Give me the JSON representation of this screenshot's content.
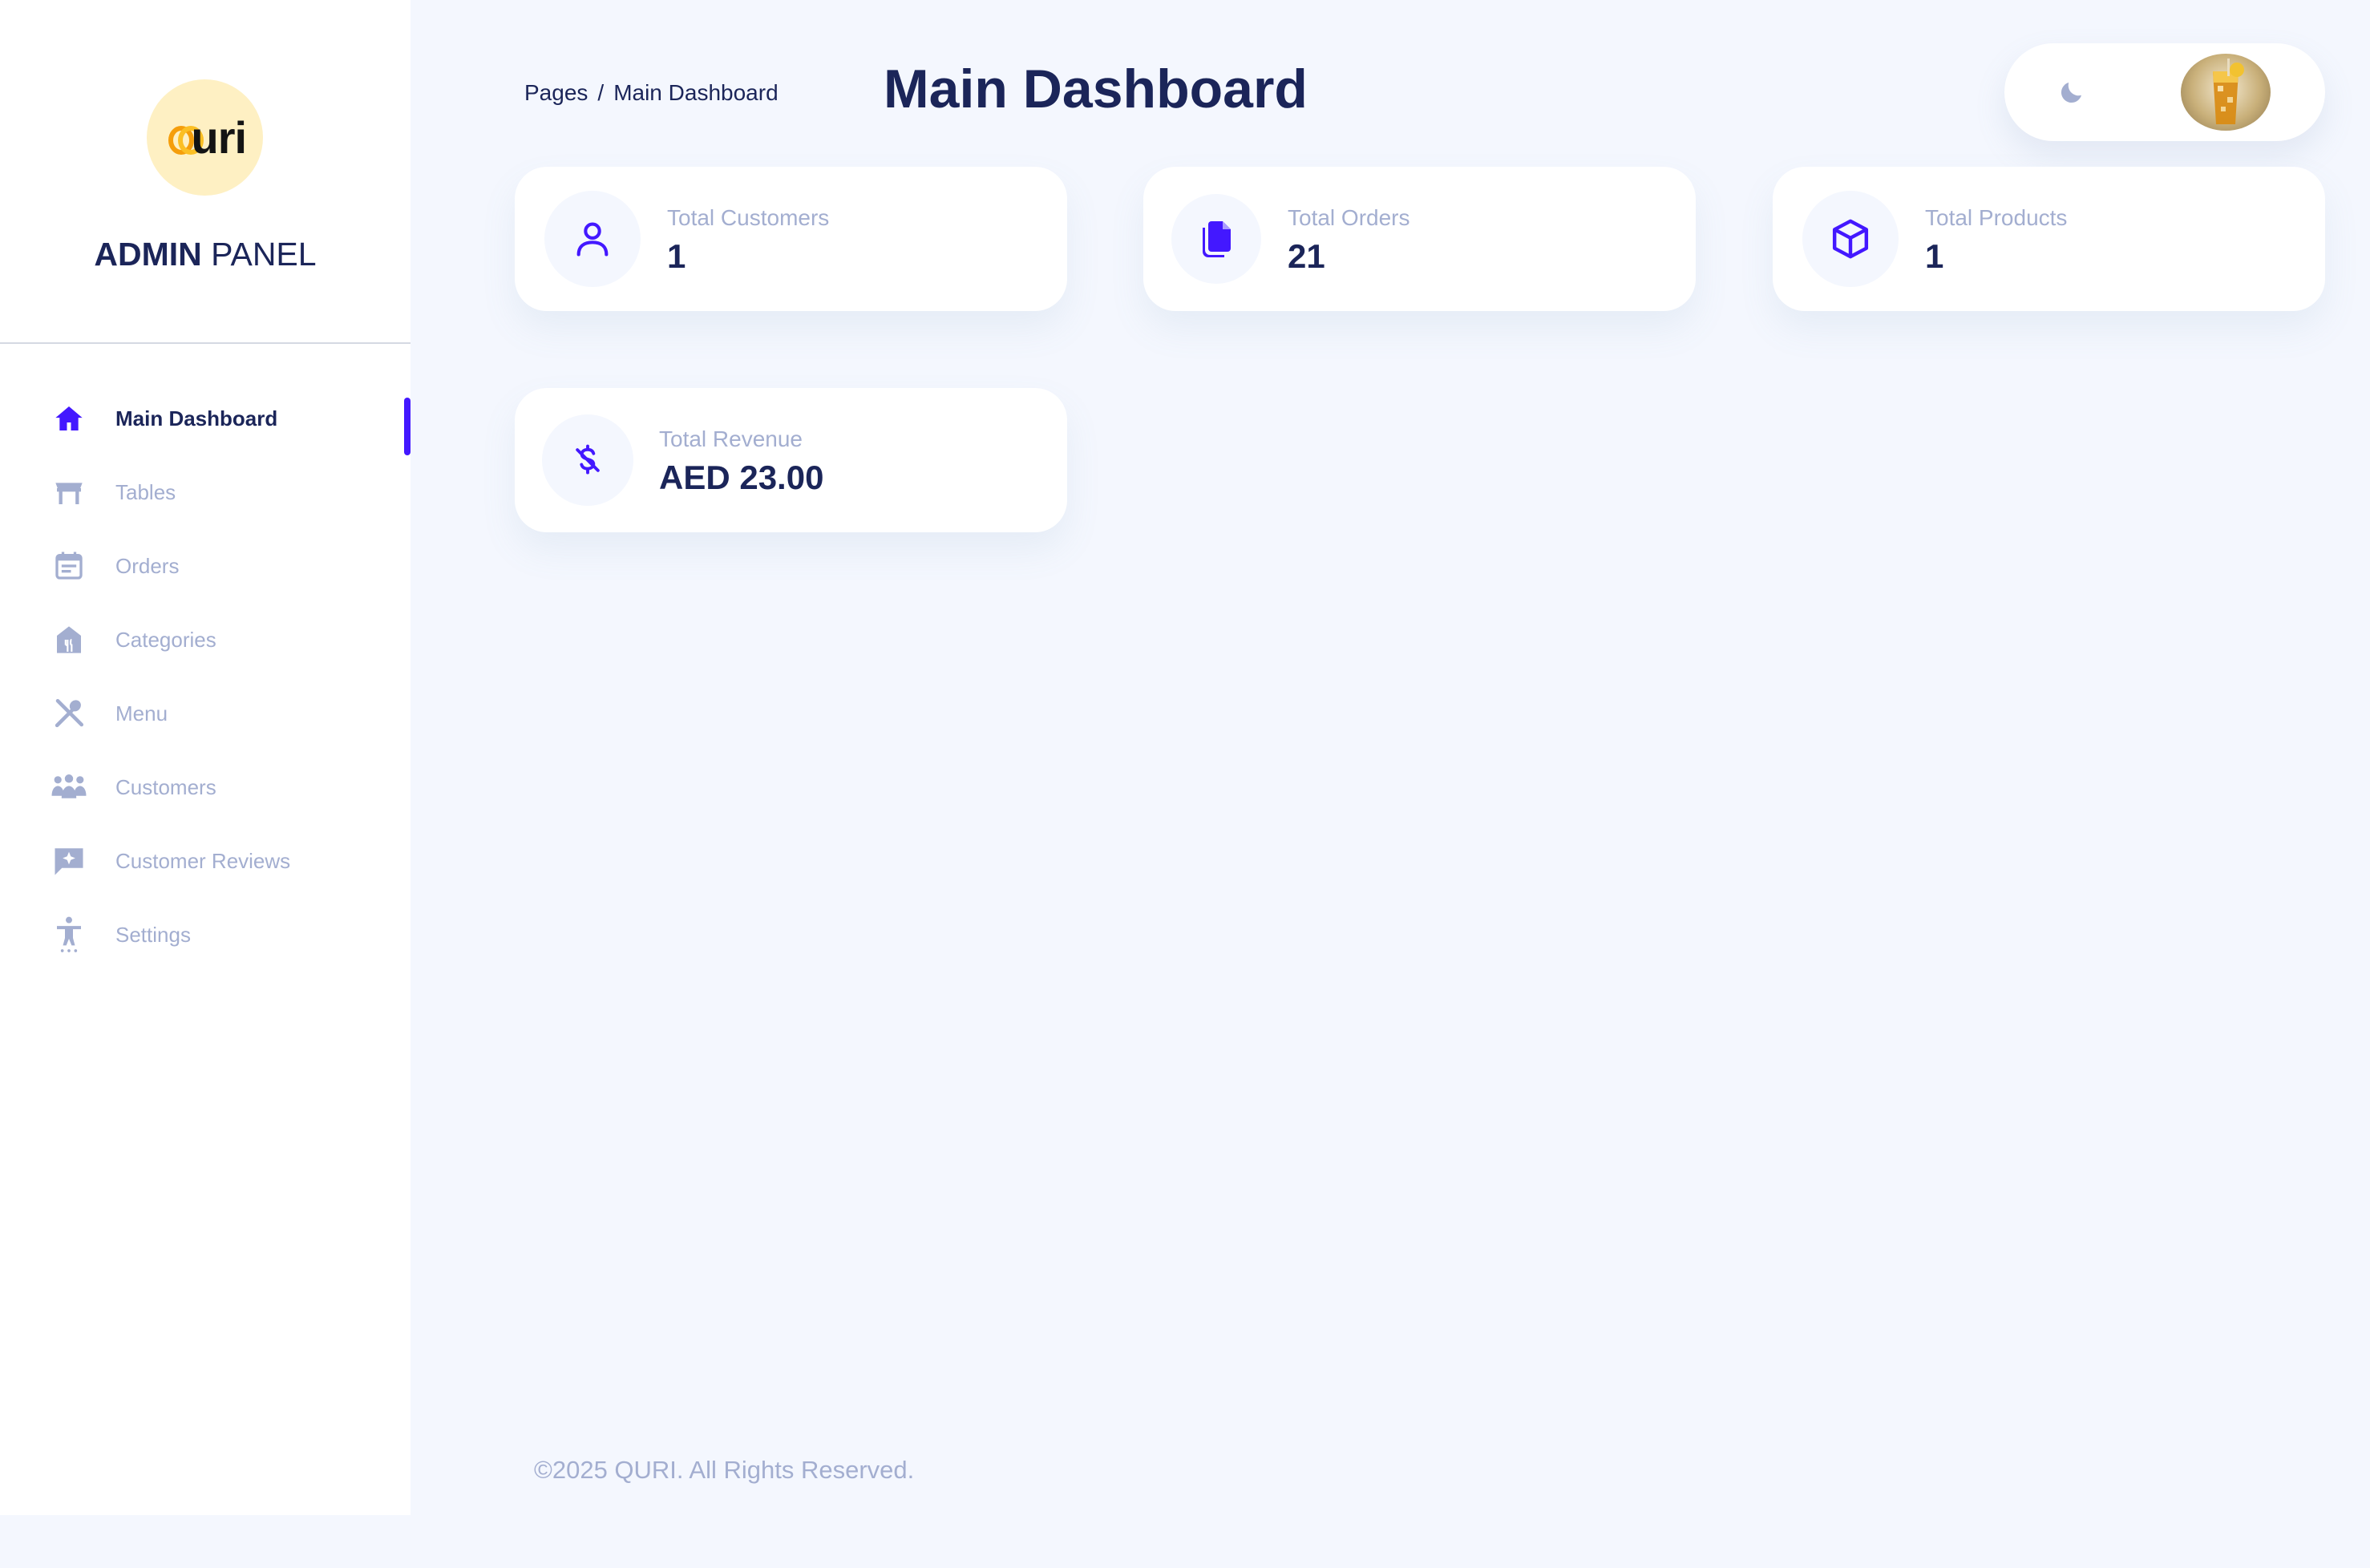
{
  "brand": {
    "logo_text": "uri",
    "title_bold": "ADMIN",
    "title_rest": "PANEL"
  },
  "sidebar": {
    "items": [
      {
        "label": "Main Dashboard",
        "icon": "home-icon",
        "active": true
      },
      {
        "label": "Tables",
        "icon": "table-icon"
      },
      {
        "label": "Orders",
        "icon": "calendar-icon"
      },
      {
        "label": "Categories",
        "icon": "store-icon"
      },
      {
        "label": "Menu",
        "icon": "utensils-icon"
      },
      {
        "label": "Customers",
        "icon": "people-icon"
      },
      {
        "label": "Customer Reviews",
        "icon": "review-icon"
      },
      {
        "label": "Settings",
        "icon": "accessibility-icon"
      }
    ]
  },
  "header": {
    "breadcrumb": {
      "parent": "Pages",
      "separator": "/",
      "current": "Main Dashboard"
    },
    "title": "Main Dashboard"
  },
  "stats": [
    {
      "label": "Total Customers",
      "value": "1",
      "icon": "user-icon"
    },
    {
      "label": "Total Orders",
      "value": "21",
      "icon": "documents-icon"
    },
    {
      "label": "Total Products",
      "value": "1",
      "icon": "box-icon"
    },
    {
      "label": "Total Revenue",
      "value": "AED 23.00",
      "icon": "dollar-icon"
    }
  ],
  "footer": {
    "text": "©2025 QURI. All Rights Reserved."
  },
  "colors": {
    "accent": "#4318FF",
    "navy": "#1B2559",
    "muted": "#A3AED0",
    "background": "#F4F7FE",
    "logo_bg": "#FEF0C3",
    "logo_orange": "#F59E0B"
  }
}
